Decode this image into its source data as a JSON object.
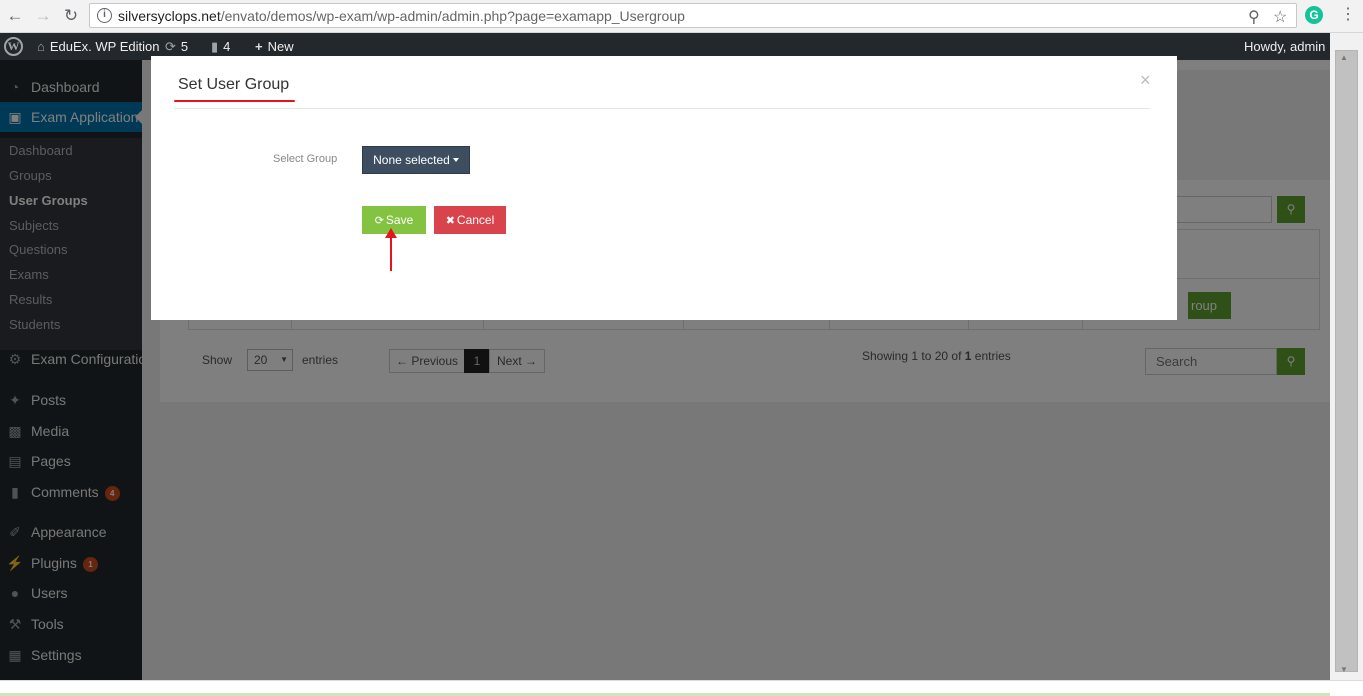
{
  "browser": {
    "url_host": "silversyclops.net",
    "url_path": "/envato/demos/wp-exam/wp-admin/admin.php?page=examapp_Usergroup",
    "back_icon": "arrow-left-icon",
    "forward_icon": "arrow-right-icon",
    "reload_icon": "reload-icon",
    "info_icon": "info-icon",
    "zoom_icon": "search-icon",
    "star_icon": "star-icon",
    "grammarly_label": "G",
    "menu_icon": "kebab-menu-icon"
  },
  "adminbar": {
    "site_name": "EduEx. WP Edition",
    "updates_count": "5",
    "comments_count": "4",
    "new_label": "New",
    "greeting": "Howdy, admin"
  },
  "sidebar": {
    "items": [
      {
        "label": "Dashboard",
        "icon": "dashboard-icon"
      },
      {
        "label": "Exam Application",
        "icon": "exam-icon"
      },
      {
        "label": "Exam Configuration",
        "icon": "gear-icon"
      },
      {
        "label": "Posts",
        "icon": "pin-icon"
      },
      {
        "label": "Media",
        "icon": "media-icon"
      },
      {
        "label": "Pages",
        "icon": "pages-icon"
      },
      {
        "label": "Comments",
        "icon": "comment-icon",
        "badge": "4"
      },
      {
        "label": "Appearance",
        "icon": "brush-icon"
      },
      {
        "label": "Plugins",
        "icon": "plugin-icon",
        "badge": "1"
      },
      {
        "label": "Users",
        "icon": "user-icon"
      },
      {
        "label": "Tools",
        "icon": "wrench-icon"
      },
      {
        "label": "Settings",
        "icon": "settings-icon"
      }
    ],
    "submenu": [
      {
        "label": "Dashboard"
      },
      {
        "label": "Groups"
      },
      {
        "label": "User Groups"
      },
      {
        "label": "Subjects"
      },
      {
        "label": "Questions"
      },
      {
        "label": "Exams"
      },
      {
        "label": "Results"
      },
      {
        "label": "Students"
      }
    ]
  },
  "background_page": {
    "search_top_partial": "rch",
    "group_button_partial": "roup",
    "show_label": "Show",
    "entries_value": "20",
    "entries_label": "entries",
    "prev_label": "← Previous",
    "page_current": "1",
    "next_label": "Next →",
    "showing_prefix": "Showing 1 to 20 of ",
    "showing_total": "1",
    "showing_suffix": " entries",
    "search_placeholder": "Search"
  },
  "modal": {
    "title": "Set User Group",
    "close_label": "×",
    "select_label": "Select Group",
    "select_value": "None selected",
    "save_label": "Save",
    "cancel_label": "Cancel",
    "accent_color": "#e8131c"
  }
}
